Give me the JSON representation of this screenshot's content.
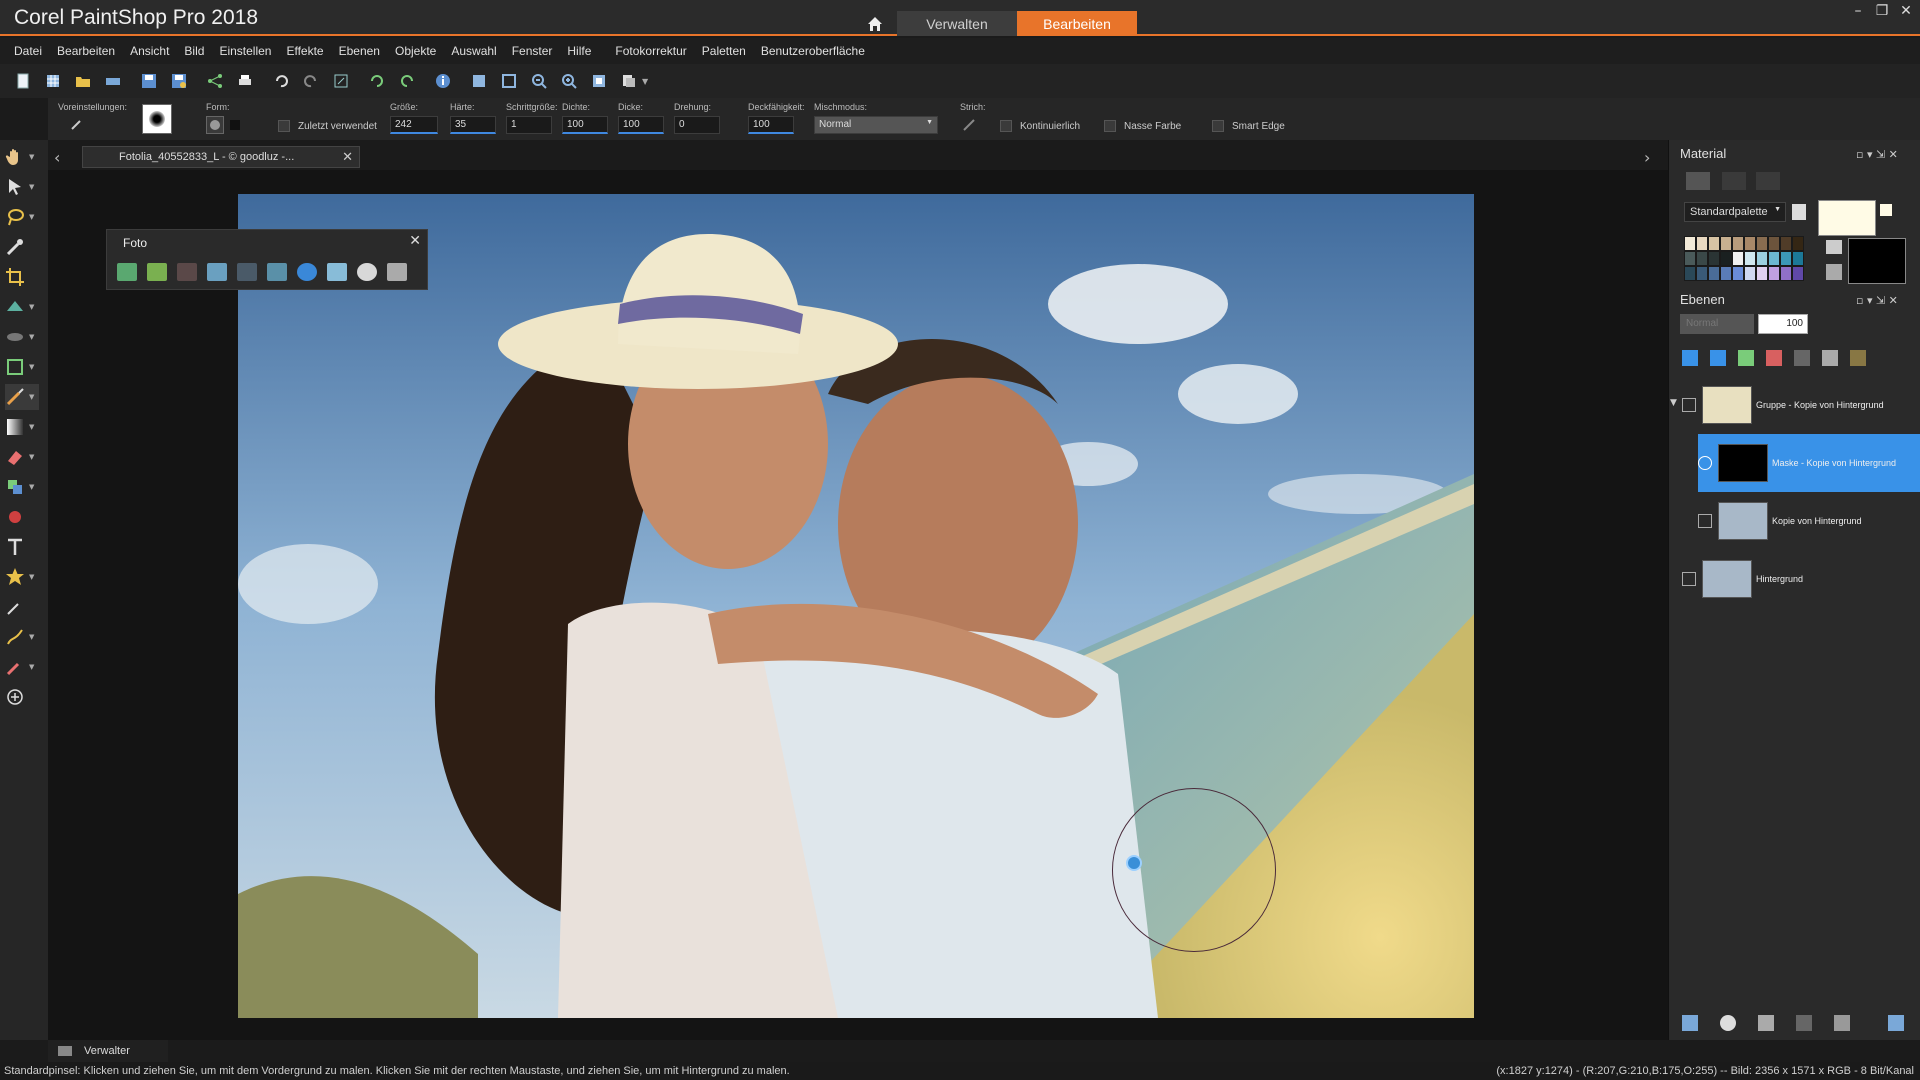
{
  "app": {
    "title": "Corel PaintShop Pro 2018",
    "tabs": [
      "Verwalten",
      "Bearbeiten"
    ],
    "accent_color": "#e8742a",
    "selection_color": "#3992e8"
  },
  "menu": [
    "Datei",
    "Bearbeiten",
    "Ansicht",
    "Bild",
    "Einstellen",
    "Effekte",
    "Ebenen",
    "Objekte",
    "Auswahl",
    "Fenster",
    "Hilfe",
    "Fotokorrektur",
    "Paletten",
    "Benutzeroberfläche"
  ],
  "options": {
    "presets_label": "Voreinstellungen:",
    "shape_label": "Form:",
    "recent_label": "Zuletzt verwendet",
    "size_label": "Größe:",
    "size_value": "242",
    "hardness_label": "Härte:",
    "hardness_value": "35",
    "step_label": "Schrittgröße:",
    "step_value": "1",
    "density_label": "Dichte:",
    "density_value": "100",
    "thickness_label": "Dicke:",
    "thickness_value": "100",
    "rotation_label": "Drehung:",
    "rotation_value": "0",
    "opacity_label": "Deckfähigkeit:",
    "opacity_value": "100",
    "blend_label": "Mischmodus:",
    "blend_value": "Normal",
    "stroke_label": "Strich:",
    "continuous_label": "Kontinuierlich",
    "wet_label": "Nasse Farbe",
    "smart_edge_label": "Smart Edge"
  },
  "document": {
    "tab_title": "Fotolia_40552833_L - © goodluz -..."
  },
  "foto_palette": {
    "title": "Foto"
  },
  "material": {
    "title": "Material",
    "palette_select": "Standardpalette"
  },
  "layers": {
    "title": "Ebenen",
    "blend": "Normal",
    "opacity": "100",
    "items": [
      {
        "name": "Gruppe - Kopie von Hintergrund"
      },
      {
        "name": "Maske - Kopie von Hintergrund"
      },
      {
        "name": "Kopie von Hintergrund"
      },
      {
        "name": "Hintergrund"
      }
    ]
  },
  "bottom_tab": "Verwalter",
  "status": {
    "left": "Standardpinsel: Klicken und ziehen Sie, um mit dem Vordergrund zu malen. Klicken Sie mit der rechten Maustaste, und ziehen Sie, um mit Hintergrund zu malen.",
    "right": "(x:1827 y:1274) - (R:207,G:210,B:175,O:255) -- Bild: 2356 x 1571 x RGB - 8 Bit/Kanal"
  }
}
